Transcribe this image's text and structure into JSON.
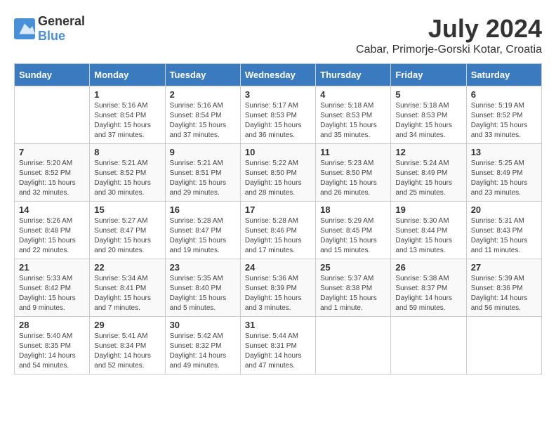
{
  "header": {
    "logo_general": "General",
    "logo_blue": "Blue",
    "month_year": "July 2024",
    "location": "Cabar, Primorje-Gorski Kotar, Croatia"
  },
  "calendar": {
    "days_of_week": [
      "Sunday",
      "Monday",
      "Tuesday",
      "Wednesday",
      "Thursday",
      "Friday",
      "Saturday"
    ],
    "weeks": [
      [
        {
          "day": "",
          "info": ""
        },
        {
          "day": "1",
          "info": "Sunrise: 5:16 AM\nSunset: 8:54 PM\nDaylight: 15 hours\nand 37 minutes."
        },
        {
          "day": "2",
          "info": "Sunrise: 5:16 AM\nSunset: 8:54 PM\nDaylight: 15 hours\nand 37 minutes."
        },
        {
          "day": "3",
          "info": "Sunrise: 5:17 AM\nSunset: 8:53 PM\nDaylight: 15 hours\nand 36 minutes."
        },
        {
          "day": "4",
          "info": "Sunrise: 5:18 AM\nSunset: 8:53 PM\nDaylight: 15 hours\nand 35 minutes."
        },
        {
          "day": "5",
          "info": "Sunrise: 5:18 AM\nSunset: 8:53 PM\nDaylight: 15 hours\nand 34 minutes."
        },
        {
          "day": "6",
          "info": "Sunrise: 5:19 AM\nSunset: 8:52 PM\nDaylight: 15 hours\nand 33 minutes."
        }
      ],
      [
        {
          "day": "7",
          "info": "Sunrise: 5:20 AM\nSunset: 8:52 PM\nDaylight: 15 hours\nand 32 minutes."
        },
        {
          "day": "8",
          "info": "Sunrise: 5:21 AM\nSunset: 8:52 PM\nDaylight: 15 hours\nand 30 minutes."
        },
        {
          "day": "9",
          "info": "Sunrise: 5:21 AM\nSunset: 8:51 PM\nDaylight: 15 hours\nand 29 minutes."
        },
        {
          "day": "10",
          "info": "Sunrise: 5:22 AM\nSunset: 8:50 PM\nDaylight: 15 hours\nand 28 minutes."
        },
        {
          "day": "11",
          "info": "Sunrise: 5:23 AM\nSunset: 8:50 PM\nDaylight: 15 hours\nand 26 minutes."
        },
        {
          "day": "12",
          "info": "Sunrise: 5:24 AM\nSunset: 8:49 PM\nDaylight: 15 hours\nand 25 minutes."
        },
        {
          "day": "13",
          "info": "Sunrise: 5:25 AM\nSunset: 8:49 PM\nDaylight: 15 hours\nand 23 minutes."
        }
      ],
      [
        {
          "day": "14",
          "info": "Sunrise: 5:26 AM\nSunset: 8:48 PM\nDaylight: 15 hours\nand 22 minutes."
        },
        {
          "day": "15",
          "info": "Sunrise: 5:27 AM\nSunset: 8:47 PM\nDaylight: 15 hours\nand 20 minutes."
        },
        {
          "day": "16",
          "info": "Sunrise: 5:28 AM\nSunset: 8:47 PM\nDaylight: 15 hours\nand 19 minutes."
        },
        {
          "day": "17",
          "info": "Sunrise: 5:28 AM\nSunset: 8:46 PM\nDaylight: 15 hours\nand 17 minutes."
        },
        {
          "day": "18",
          "info": "Sunrise: 5:29 AM\nSunset: 8:45 PM\nDaylight: 15 hours\nand 15 minutes."
        },
        {
          "day": "19",
          "info": "Sunrise: 5:30 AM\nSunset: 8:44 PM\nDaylight: 15 hours\nand 13 minutes."
        },
        {
          "day": "20",
          "info": "Sunrise: 5:31 AM\nSunset: 8:43 PM\nDaylight: 15 hours\nand 11 minutes."
        }
      ],
      [
        {
          "day": "21",
          "info": "Sunrise: 5:33 AM\nSunset: 8:42 PM\nDaylight: 15 hours\nand 9 minutes."
        },
        {
          "day": "22",
          "info": "Sunrise: 5:34 AM\nSunset: 8:41 PM\nDaylight: 15 hours\nand 7 minutes."
        },
        {
          "day": "23",
          "info": "Sunrise: 5:35 AM\nSunset: 8:40 PM\nDaylight: 15 hours\nand 5 minutes."
        },
        {
          "day": "24",
          "info": "Sunrise: 5:36 AM\nSunset: 8:39 PM\nDaylight: 15 hours\nand 3 minutes."
        },
        {
          "day": "25",
          "info": "Sunrise: 5:37 AM\nSunset: 8:38 PM\nDaylight: 15 hours\nand 1 minute."
        },
        {
          "day": "26",
          "info": "Sunrise: 5:38 AM\nSunset: 8:37 PM\nDaylight: 14 hours\nand 59 minutes."
        },
        {
          "day": "27",
          "info": "Sunrise: 5:39 AM\nSunset: 8:36 PM\nDaylight: 14 hours\nand 56 minutes."
        }
      ],
      [
        {
          "day": "28",
          "info": "Sunrise: 5:40 AM\nSunset: 8:35 PM\nDaylight: 14 hours\nand 54 minutes."
        },
        {
          "day": "29",
          "info": "Sunrise: 5:41 AM\nSunset: 8:34 PM\nDaylight: 14 hours\nand 52 minutes."
        },
        {
          "day": "30",
          "info": "Sunrise: 5:42 AM\nSunset: 8:32 PM\nDaylight: 14 hours\nand 49 minutes."
        },
        {
          "day": "31",
          "info": "Sunrise: 5:44 AM\nSunset: 8:31 PM\nDaylight: 14 hours\nand 47 minutes."
        },
        {
          "day": "",
          "info": ""
        },
        {
          "day": "",
          "info": ""
        },
        {
          "day": "",
          "info": ""
        }
      ]
    ]
  }
}
